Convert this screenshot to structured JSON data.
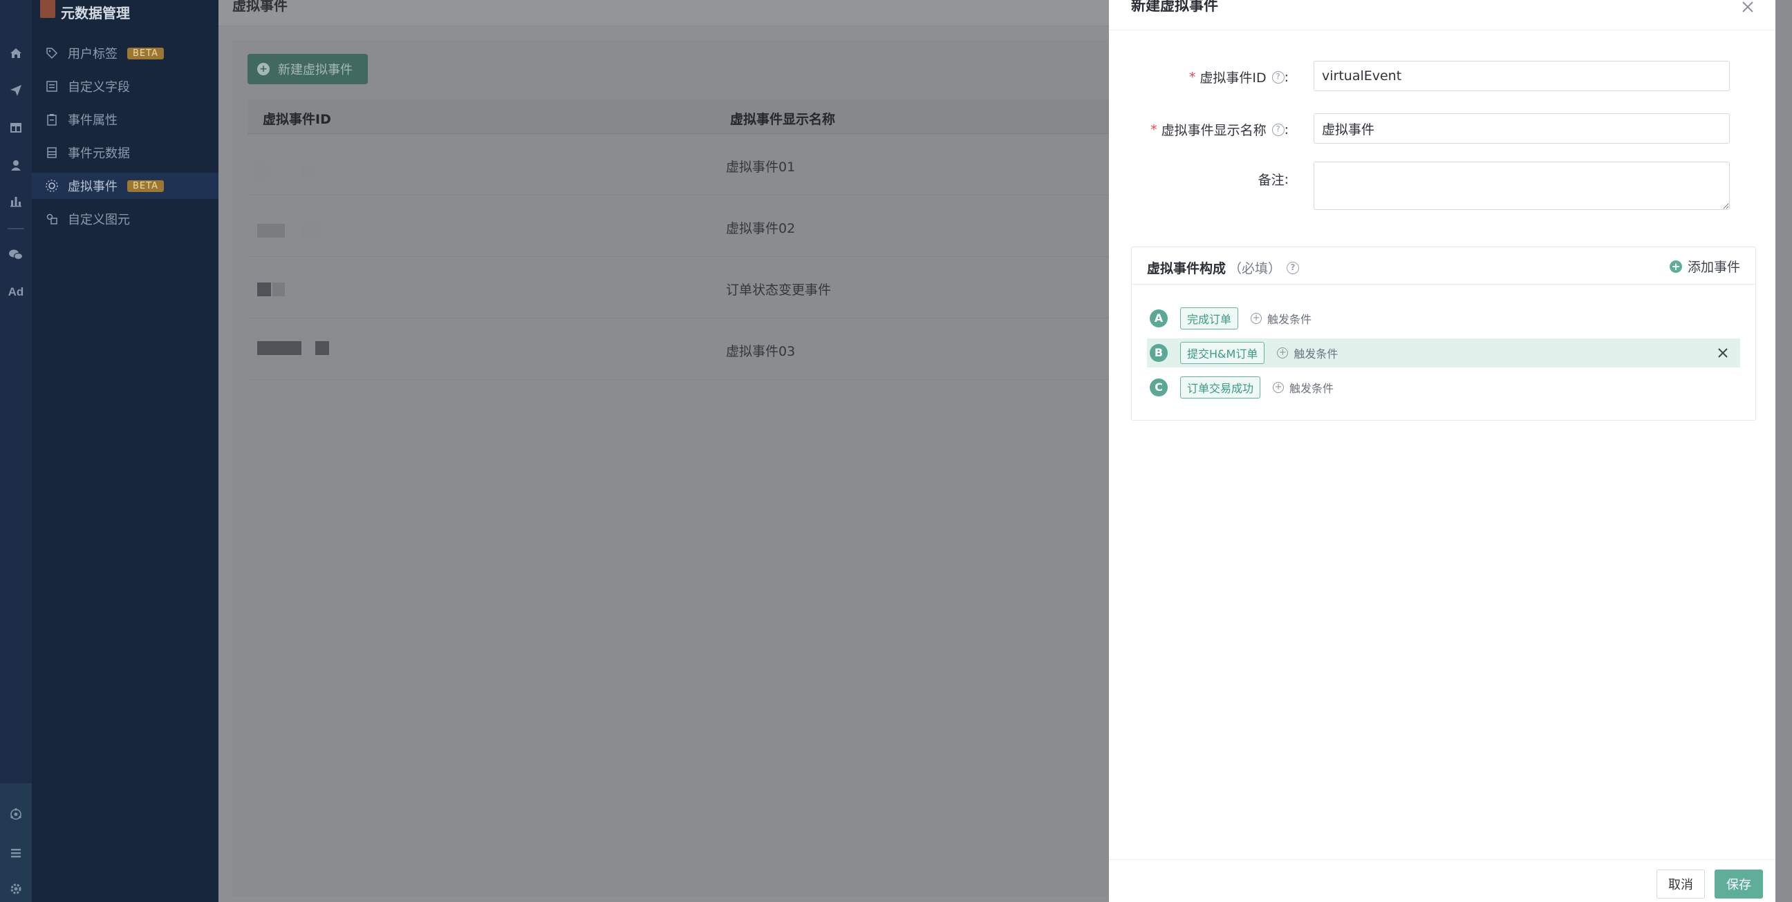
{
  "sidebar": {
    "title": "元数据管理",
    "items": [
      {
        "label": "用户标签",
        "badge": "BETA",
        "icon": "tag-icon"
      },
      {
        "label": "自定义字段",
        "icon": "field-icon"
      },
      {
        "label": "事件属性",
        "icon": "clipboard-icon"
      },
      {
        "label": "事件元数据",
        "icon": "list-doc-icon"
      },
      {
        "label": "虚拟事件",
        "badge": "BETA",
        "icon": "virtual-event-icon",
        "active": true
      },
      {
        "label": "自定义图元",
        "icon": "shapes-icon"
      }
    ]
  },
  "rail": {
    "icons": [
      "home-icon",
      "send-icon",
      "table-icon",
      "user-icon",
      "bar-chart-icon",
      "wechat-icon"
    ],
    "ad_label": "Ad",
    "bottom_icons": [
      "network-icon",
      "menu-icon",
      "gear-icon"
    ]
  },
  "main": {
    "header_title": "虚拟事件",
    "new_button": "新建虚拟事件",
    "columns": [
      "虚拟事件ID",
      "虚拟事件显示名称"
    ],
    "rows": [
      {
        "display_name": "虚拟事件01"
      },
      {
        "display_name": "虚拟事件02"
      },
      {
        "display_name": "订单状态变更事件"
      },
      {
        "display_name": "虚拟事件03"
      }
    ]
  },
  "drawer": {
    "title": "新建虚拟事件",
    "fields": {
      "id_label": "虚拟事件ID",
      "id_value": "virtualEvent",
      "name_label": "虚拟事件显示名称",
      "name_value": "虚拟事件",
      "note_label": "备注"
    },
    "composition": {
      "title": "虚拟事件构成",
      "required_hint": "（必填）",
      "add_label": "添加事件",
      "events": [
        {
          "letter": "A",
          "tag": "完成订单",
          "trigger": "触发条件"
        },
        {
          "letter": "B",
          "tag": "提交H&M订单",
          "trigger": "触发条件",
          "highlighted": true
        },
        {
          "letter": "C",
          "tag": "订单交易成功",
          "trigger": "触发条件"
        }
      ]
    },
    "footer": {
      "cancel": "取消",
      "save": "保存"
    }
  },
  "colors": {
    "accent": "#5fae9a",
    "required": "#e5484d",
    "beta_badge": "#9a7733"
  }
}
